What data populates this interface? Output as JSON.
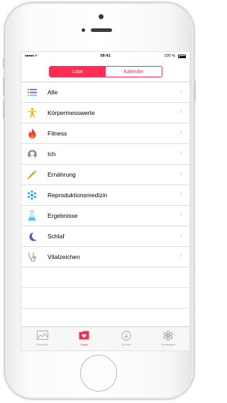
{
  "statusbar": {
    "signal": "●●●●● ᯤ",
    "time": "09:41",
    "battery": "100 %"
  },
  "segmented": {
    "items": [
      "Liste",
      "Kalender"
    ],
    "selected": "Liste"
  },
  "list": [
    {
      "label": "Alle",
      "icon": "list-icon",
      "color": "#5856d6"
    },
    {
      "label": "Körpermesswerte",
      "icon": "body-figure-icon",
      "color": "#ff9500"
    },
    {
      "label": "Fitness",
      "icon": "flame-icon",
      "color": "#ff3b30"
    },
    {
      "label": "Ich",
      "icon": "person-icon",
      "color": "#8e8e93"
    },
    {
      "label": "Ernährung",
      "icon": "carrot-icon",
      "color": "#ff9500"
    },
    {
      "label": "Reproduktionsmedizin",
      "icon": "snowflake-icon",
      "color": "#34aadc"
    },
    {
      "label": "Ergebnisse",
      "icon": "flask-icon",
      "color": "#5ac8fa"
    },
    {
      "label": "Schlaf",
      "icon": "moon-icon",
      "color": "#5856d6"
    },
    {
      "label": "Vitalzeichen",
      "icon": "stethoscope-icon",
      "color": "#8e8e93"
    }
  ],
  "tabs": [
    {
      "label": "Übersicht",
      "icon": "chart-icon"
    },
    {
      "label": "Daten",
      "icon": "folder-heart-icon"
    },
    {
      "label": "Quellen",
      "icon": "download-icon"
    },
    {
      "label": "Notfallpass",
      "icon": "asterisk-icon"
    }
  ],
  "colors": {
    "accent": "#ff2d55"
  }
}
